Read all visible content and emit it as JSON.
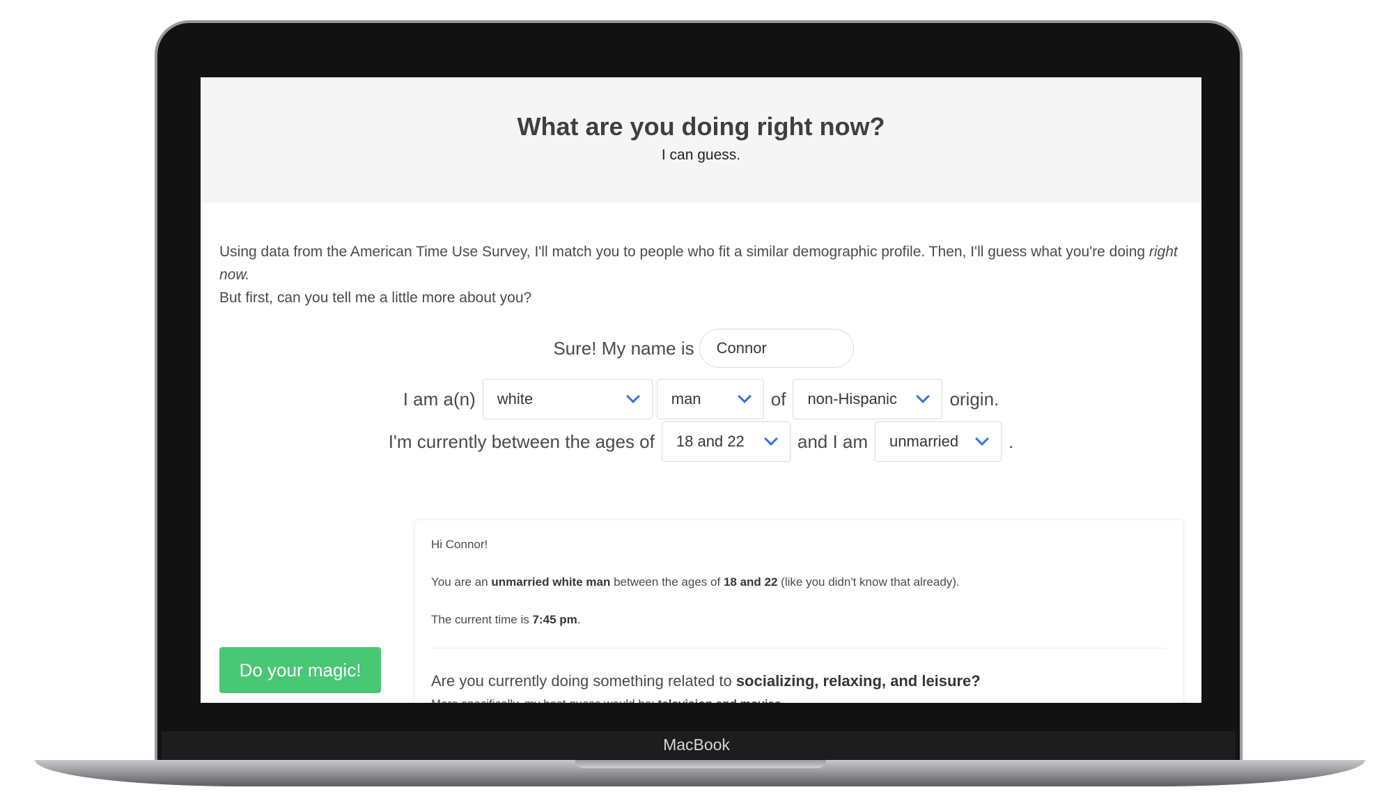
{
  "device": {
    "brand": "MacBook"
  },
  "hero": {
    "title": "What are you doing right now?",
    "subtitle": "I can guess."
  },
  "intro": {
    "line1": "Using data from the American Time Use Survey, I'll match you to people who fit a similar demographic profile. Then, I'll guess what you're doing ",
    "line1_em": "right now.",
    "line2": "But first, can you tell me a little more about you?"
  },
  "form": {
    "name_prefix": "Sure! My name is",
    "name_value": "Connor",
    "iam_prefix": "I am a(n)",
    "race": "white",
    "gender": "man",
    "of_text": "of",
    "origin": "non-Hispanic",
    "origin_suffix": "origin.",
    "age_prefix": "I'm currently between the ages of",
    "age": "18 and 22",
    "and_text": "and I am",
    "marital": "unmarried",
    "period": "."
  },
  "button": {
    "label": "Do your magic!",
    "color": "#48c774"
  },
  "result": {
    "greeting": "Hi Connor!",
    "you_are_prefix": "You are an",
    "profile": "unmarried white man",
    "between_text": "between the ages of",
    "age": "18 and 22",
    "aside": "(like you didn't know that already).",
    "time_prefix": "The current time is",
    "time": "7:45 pm",
    "time_suffix": ".",
    "guess_prefix": "Are you currently doing something related to",
    "guess_category": "socializing, relaxing, and leisure?",
    "specific_prefix": "More specifically, my best guess would be:",
    "specific_value": "television and movies"
  },
  "colors": {
    "accent": "#3273dc",
    "hero_bg": "#f5f5f5"
  }
}
